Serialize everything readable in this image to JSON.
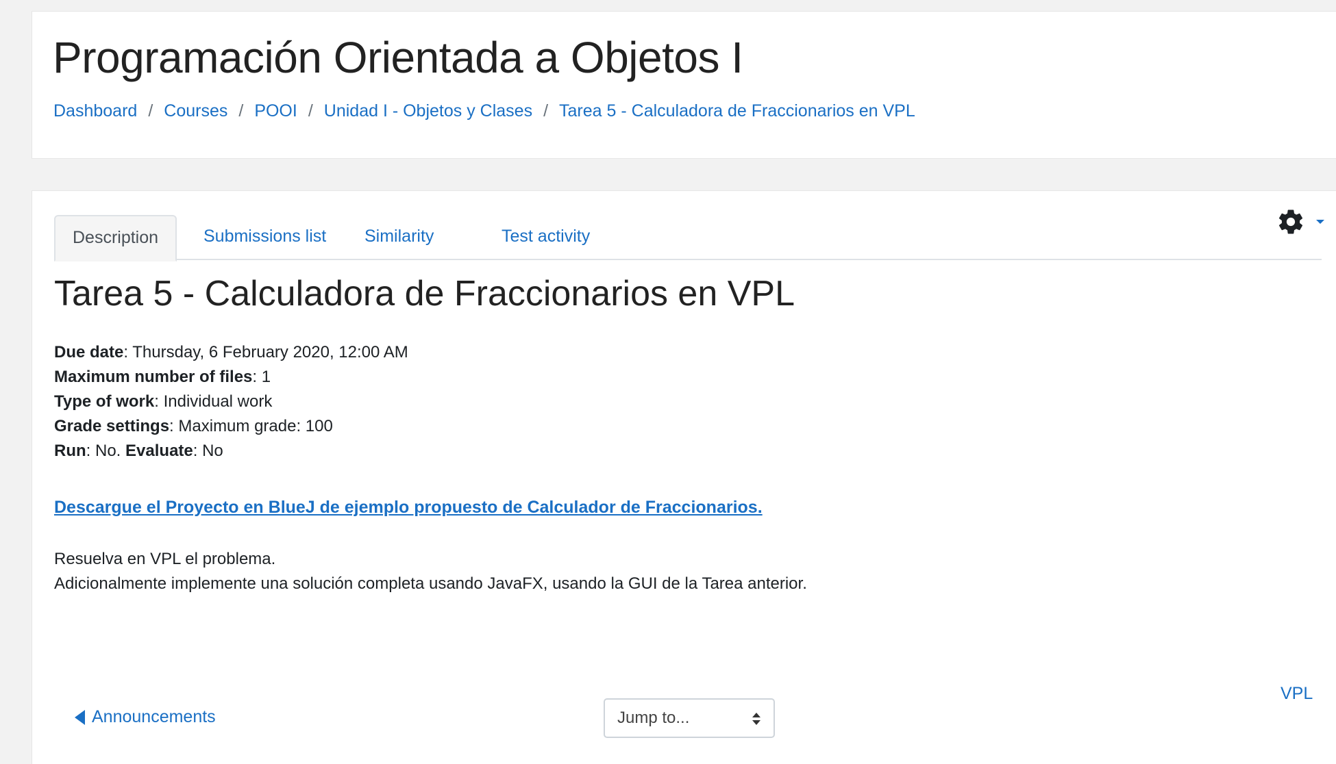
{
  "header": {
    "course_title": "Programación Orientada a Objetos I",
    "breadcrumb": [
      "Dashboard",
      "Courses",
      "POOI",
      "Unidad I - Objetos y Clases",
      "Tarea 5 - Calculadora de Fraccionarios en VPL"
    ],
    "breadcrumb_separator": "/"
  },
  "tabs": [
    {
      "label": "Description",
      "active": true
    },
    {
      "label": "Submissions list",
      "active": false
    },
    {
      "label": "Similarity",
      "active": false
    },
    {
      "label": "Test activity",
      "active": false
    }
  ],
  "settings": {
    "icon": "gear-icon"
  },
  "activity": {
    "title": "Tarea 5 - Calculadora de Fraccionarios en VPL",
    "details": {
      "due_date_label": "Due date",
      "due_date_value": "Thursday, 6 February 2020, 12:00 AM",
      "max_files_label": "Maximum number of files",
      "max_files_value": "1",
      "work_type_label": "Type of work",
      "work_type_value": "Individual work",
      "grade_label": "Grade settings",
      "grade_value": "Maximum grade: 100",
      "run_label": "Run",
      "run_value": "No.",
      "evaluate_label": "Evaluate",
      "evaluate_value": "No"
    },
    "download_link": "Descargue el Proyecto en BlueJ de ejemplo propuesto de Calculador de Fraccionarios.",
    "description_lines": [
      "Resuelva en VPL el problema.",
      "Adicionalmente implemente una solución completa usando JavaFX, usando la GUI de la Tarea anterior."
    ]
  },
  "navigation": {
    "next_label": "VPL",
    "prev_label": "Announcements",
    "jump_to_selected": "Jump to..."
  },
  "colors": {
    "link": "#1a6fc4",
    "page_background": "#f2f2f2",
    "card_background": "#ffffff"
  }
}
